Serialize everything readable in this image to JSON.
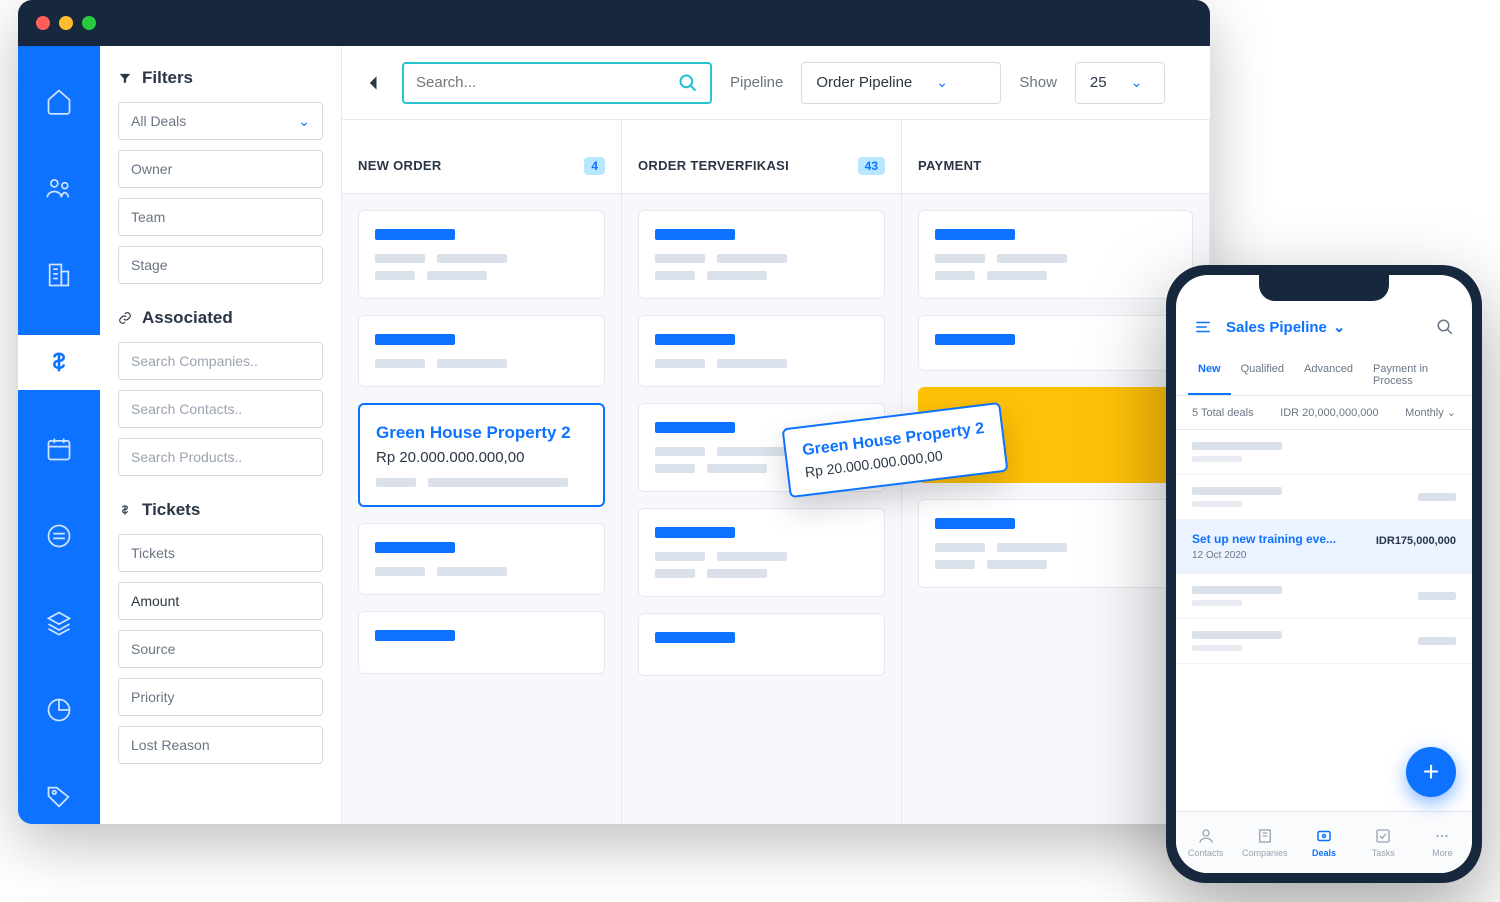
{
  "filters": {
    "heading": "Filters",
    "all_deals": "All Deals",
    "owner": "Owner",
    "team": "Team",
    "stage": "Stage",
    "associated_heading": "Associated",
    "search_companies": "Search Companies..",
    "search_contacts": "Search Contacts..",
    "search_products": "Search Products..",
    "tickets_heading": "Tickets",
    "tickets": "Tickets",
    "amount": "Amount",
    "source": "Source",
    "priority": "Priority",
    "lost_reason": "Lost Reason"
  },
  "toolbar": {
    "search_placeholder": "Search...",
    "pipeline_label": "Pipeline",
    "pipeline_value": "Order Pipeline",
    "show_label": "Show",
    "show_value": "25"
  },
  "columns": {
    "c1": {
      "title": "NEW ORDER",
      "count": "4"
    },
    "c2": {
      "title": "ORDER TERVERFIKASI",
      "count": "43"
    },
    "c3": {
      "title": "PAYMENT"
    }
  },
  "featured_card": {
    "title": "Green House Property 2",
    "amount": "Rp 20.000.000.000,00"
  },
  "dragging_card": {
    "title": "Green House Property 2",
    "amount": "Rp 20.000.000.000,00"
  },
  "phone": {
    "title": "Sales Pipeline",
    "tabs": {
      "new": "New",
      "qualified": "Qualified",
      "advanced": "Advanced",
      "payment": "Payment in Process"
    },
    "meta": {
      "total": "5 Total deals",
      "amount": "IDR 20,000,000,000",
      "period": "Monthly"
    },
    "active_deal": {
      "title": "Set up new training eve...",
      "date": "12 Oct 2020",
      "amount": "IDR175,000,000"
    },
    "nav": {
      "contacts": "Contacts",
      "companies": "Companies",
      "deals": "Deals",
      "tasks": "Tasks",
      "more": "More"
    }
  }
}
